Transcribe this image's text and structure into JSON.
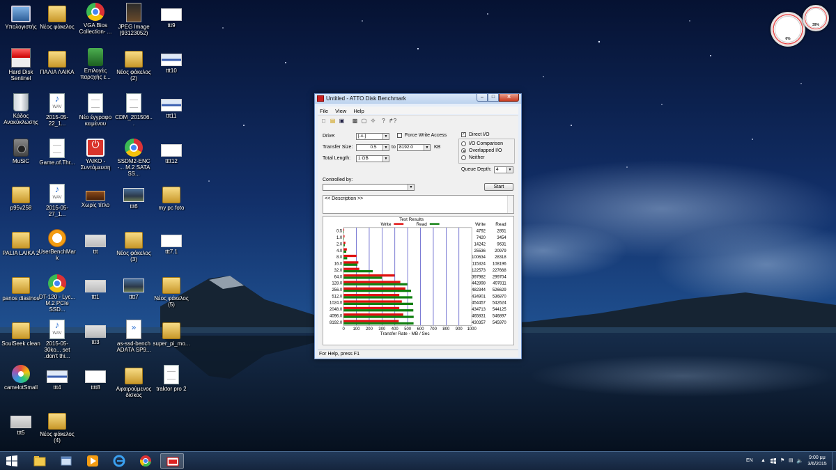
{
  "desktop": {
    "icons": [
      {
        "label": "Υπολογιστής",
        "icon": "computer-icon"
      },
      {
        "label": "Νέος φάκελος",
        "icon": "folder-icon"
      },
      {
        "label": "VGA Bios Collection- ...",
        "icon": "chrome-icon"
      },
      {
        "label": "JPEG Image (93123052)",
        "icon": "image-icon"
      },
      {
        "label": "ttt9",
        "icon": "thumbnail-icon"
      },
      {
        "label": "Hard Disk Sentinel",
        "icon": "hard-disk-sentinel-icon"
      },
      {
        "label": "ΠΑΛΙΑ ΛΑΙΚΑ",
        "icon": "folder-icon"
      },
      {
        "label": "Επιλογές παροχής ε...",
        "icon": "power-options-icon"
      },
      {
        "label": "Νέος φάκελος (2)",
        "icon": "folder-icon"
      },
      {
        "label": "ttt10",
        "icon": "thumbnail-icon"
      },
      {
        "label": "Κάδος Ανακύκλωσης",
        "icon": "recycle-bin-icon"
      },
      {
        "label": "2015-05-22_1...",
        "icon": "wav-file-icon"
      },
      {
        "label": "Νέο έγγραφο κειμένου",
        "icon": "text-document-icon"
      },
      {
        "label": "CDM_201506...",
        "icon": "document-icon"
      },
      {
        "label": "ttt11",
        "icon": "thumbnail-icon"
      },
      {
        "label": "MuSiC",
        "icon": "speaker-icon"
      },
      {
        "label": "Game.of.Thr...",
        "icon": "document-icon"
      },
      {
        "label": "ΥΛΙΚΟ - Συντόμευση",
        "icon": "power-shortcut-icon"
      },
      {
        "label": "SSDM2-ENC -... M.2 SATA SS...",
        "icon": "chrome-icon"
      },
      {
        "label": "tttt12",
        "icon": "thumbnail-icon"
      },
      {
        "label": "p95v258",
        "icon": "folder-icon"
      },
      {
        "label": "2015-05-27_1...",
        "icon": "wav-file-icon"
      },
      {
        "label": "Χωρίς τίτλο",
        "icon": "chest-icon"
      },
      {
        "label": "ttt6",
        "icon": "photo-icon"
      },
      {
        "label": "my pc foto",
        "icon": "folder-icon"
      },
      {
        "label": "PALIA LAIKA 2",
        "icon": "folder-icon"
      },
      {
        "label": "UserBenchMark",
        "icon": "userbenchmark-icon"
      },
      {
        "label": "ttt",
        "icon": "thumbnail-icon"
      },
      {
        "label": "Νέος φάκελος (3)",
        "icon": "folder-icon"
      },
      {
        "label": "ttt7.1",
        "icon": "thumbnail-icon"
      },
      {
        "label": "panos diasinos",
        "icon": "folder-icon"
      },
      {
        "label": "DT-120 - Lyc... M.2 PCIe SSD...",
        "icon": "chrome-icon"
      },
      {
        "label": "ttt1",
        "icon": "thumbnail-icon"
      },
      {
        "label": "tttt7",
        "icon": "photo-icon"
      },
      {
        "label": "Νέος φάκελος (5)",
        "icon": "folder-icon"
      },
      {
        "label": "SoulSeek clean",
        "icon": "folder-icon"
      },
      {
        "label": "2015-05-30ko... set .don't thi...",
        "icon": "wav-file-icon"
      },
      {
        "label": "ttt3",
        "icon": "thumbnail-icon"
      },
      {
        "label": "as-ssd-bench ADATA SP9...",
        "icon": "xml-file-icon"
      },
      {
        "label": "super_pi_mo...",
        "icon": "folder-icon"
      },
      {
        "label": "camelotSmall",
        "icon": "disc-icon"
      },
      {
        "label": "ttt4",
        "icon": "thumbnail-icon"
      },
      {
        "label": "tttt8",
        "icon": "thumbnail-icon"
      },
      {
        "label": "Αφαιρούμενος δίσκος",
        "icon": "removable-disk-icon"
      },
      {
        "label": "traktor pro 2",
        "icon": "document-icon"
      },
      {
        "label": "ttt5",
        "icon": "thumbnail-icon"
      },
      {
        "label": "Νέος φάκελος (4)",
        "icon": "folder-icon"
      }
    ]
  },
  "gauges": {
    "cpu": "6%",
    "mem": "39%"
  },
  "atto": {
    "title": "Untitled - ATTO Disk Benchmark",
    "controls": {
      "minimize": "–",
      "maximize": "□",
      "close": "✕"
    },
    "menu": [
      "File",
      "View",
      "Help"
    ],
    "toolbar_icons": [
      "new-icon",
      "open-icon",
      "save-icon",
      "print-icon",
      "print-preview-icon",
      "move-icon",
      "help-icon",
      "context-help-icon"
    ],
    "drive_label": "Drive:",
    "drive_value": "[-c-]",
    "force_write_label": "Force Write Access",
    "direct_io_label": "Direct I/O",
    "transfer_size_label": "Transfer Size:",
    "transfer_from": "0.5",
    "to_label": "to",
    "transfer_to": "8192.0",
    "kb_label": "KB",
    "total_length_label": "Total Length:",
    "total_length_value": "1 GB",
    "io_comparison_label": "I/O Comparison",
    "overlapped_io_label": "Overlapped I/O",
    "neither_label": "Neither",
    "queue_depth_label": "Queue Depth:",
    "queue_depth_value": "4",
    "controlled_by_label": "Controlled by:",
    "controlled_by_value": "",
    "start_label": "Start",
    "description": "<< Description >>",
    "status": "For Help, press F1",
    "colors": {
      "write": "#e01010",
      "read": "#108010"
    }
  },
  "chart_data": {
    "type": "bar",
    "orientation": "horizontal",
    "title": "Test Results",
    "xlabel": "Transfer Rate - MB / Sec",
    "xlim": [
      0,
      1000
    ],
    "xticks": [
      0,
      100,
      200,
      300,
      400,
      500,
      600,
      700,
      800,
      900,
      1000
    ],
    "legend": [
      "Write",
      "Read"
    ],
    "value_headers": [
      "Write",
      "Read"
    ],
    "categories": [
      "0.5",
      "1.0",
      "2.0",
      "4.0",
      "8.0",
      "16.0",
      "32.0",
      "64.0",
      "128.0",
      "256.0",
      "512.0",
      "1024.0",
      "2048.0",
      "4096.0",
      "8192.0"
    ],
    "series": [
      {
        "name": "Write",
        "color": "#e01010",
        "values": [
          4.792,
          7.42,
          14.242,
          25.536,
          100.634,
          115.324,
          122.573,
          397.982,
          442.898,
          482.344,
          434.901,
          454.457,
          434.713,
          465.831,
          430.357
        ],
        "labels": [
          "4792",
          "7420",
          "14242",
          "25536",
          "100634",
          "115324",
          "122573",
          "397982",
          "442898",
          "482344",
          "434901",
          "454457",
          "434713",
          "465831",
          "430357"
        ]
      },
      {
        "name": "Read",
        "color": "#108010",
        "values": [
          2.851,
          3.454,
          9.631,
          20.979,
          28.318,
          108.196,
          227.668,
          299.704,
          497.811,
          526.629,
          536.87,
          542.624,
          544.125,
          546.897,
          545.97
        ],
        "labels": [
          "2851",
          "3454",
          "9631",
          "20979",
          "28318",
          "108196",
          "227668",
          "299704",
          "497811",
          "526629",
          "536870",
          "542624",
          "544125",
          "546897",
          "545970"
        ]
      }
    ]
  },
  "taskbar": {
    "items": [
      {
        "name": "start-button",
        "icon": "windows-logo-icon"
      },
      {
        "name": "taskbar-file-explorer",
        "icon": "folder-icon"
      },
      {
        "name": "taskbar-control-panel",
        "icon": "window-icon"
      },
      {
        "name": "taskbar-media-player",
        "icon": "media-player-icon"
      },
      {
        "name": "taskbar-internet-explorer",
        "icon": "internet-explorer-icon"
      },
      {
        "name": "taskbar-chrome",
        "icon": "chrome-icon"
      },
      {
        "name": "taskbar-atto",
        "icon": "atto-icon"
      }
    ],
    "language": "EN",
    "time": "9:00 μμ",
    "date": "3/6/2015"
  }
}
